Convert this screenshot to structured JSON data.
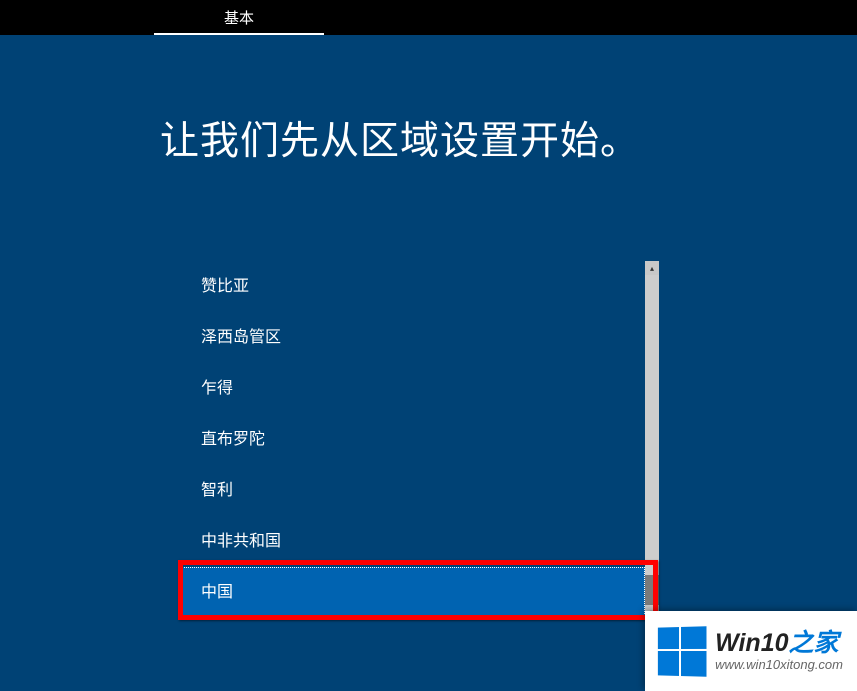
{
  "topbar": {
    "tabs": [
      {
        "label": "基本",
        "active": true
      }
    ]
  },
  "title": "让我们先从区域设置开始。",
  "region_list": {
    "items": [
      {
        "label": "赞比亚",
        "selected": false
      },
      {
        "label": "泽西岛管区",
        "selected": false
      },
      {
        "label": "乍得",
        "selected": false
      },
      {
        "label": "直布罗陀",
        "selected": false
      },
      {
        "label": "智利",
        "selected": false
      },
      {
        "label": "中非共和国",
        "selected": false
      },
      {
        "label": "中国",
        "selected": true
      }
    ]
  },
  "scrollbar": {
    "up_glyph": "▴",
    "down_glyph": "▾"
  },
  "watermark": {
    "title_prefix": "Win10",
    "title_suffix": "之家",
    "url": "www.win10xitong.com"
  }
}
